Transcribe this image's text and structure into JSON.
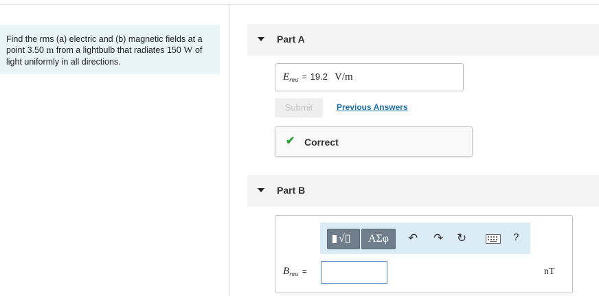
{
  "problem": {
    "text_1": "Find the rms (a) electric and (b) magnetic fields at a point 3.50 ",
    "distance_unit": "m",
    "text_2": " from a lightbulb that radiates 150 ",
    "power_unit": "W",
    "text_3": " of light uniformly in all directions."
  },
  "partA": {
    "title": "Part A",
    "answer_var": "E",
    "answer_sub": "rms",
    "equals": "=",
    "answer_value": "19.2",
    "answer_unit": "V/m",
    "submit_label": "Submit",
    "previous_answers_label": "Previous Answers",
    "feedback_label": "Correct"
  },
  "partB": {
    "title": "Part B",
    "toolbar": {
      "templates_icon": "fraction-radical-template-icon",
      "symbols_label": "ΑΣφ",
      "undo_icon": "undo-icon",
      "redo_icon": "redo-icon",
      "reset_icon": "reset-icon",
      "keyboard_icon": "keyboard-icon",
      "help_label": "?"
    },
    "answer_var": "B",
    "answer_sub": "rms",
    "equals": "=",
    "answer_value": "",
    "answer_unit": "nT"
  },
  "colors": {
    "problem_bg": "#e8f4f6",
    "link": "#1f6fa6",
    "correct_check": "#2e9c3a",
    "toolbar_bg": "#dcecf7",
    "input_border": "#4a86c5"
  }
}
